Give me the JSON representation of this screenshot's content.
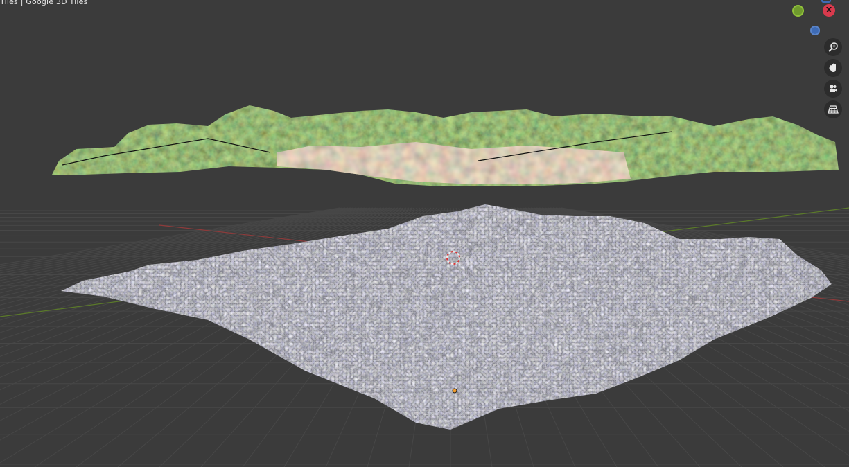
{
  "viewport": {
    "overlay_label": "Tiles | Google 3D Tiles",
    "background": "#3b3b3b",
    "grid_color": "#474747",
    "x_axis_color": "#8e3b3b",
    "y_axis_color": "#5b7a2a"
  },
  "gizmo": {
    "x_label": "X",
    "x_color": "#d93a4d",
    "y_color": "#6f9a2e",
    "z_color": "#3e6bb5"
  },
  "nav_tools": [
    {
      "name": "zoom-icon"
    },
    {
      "name": "pan-hand-icon"
    },
    {
      "name": "camera-icon"
    },
    {
      "name": "perspective-grid-icon"
    }
  ]
}
